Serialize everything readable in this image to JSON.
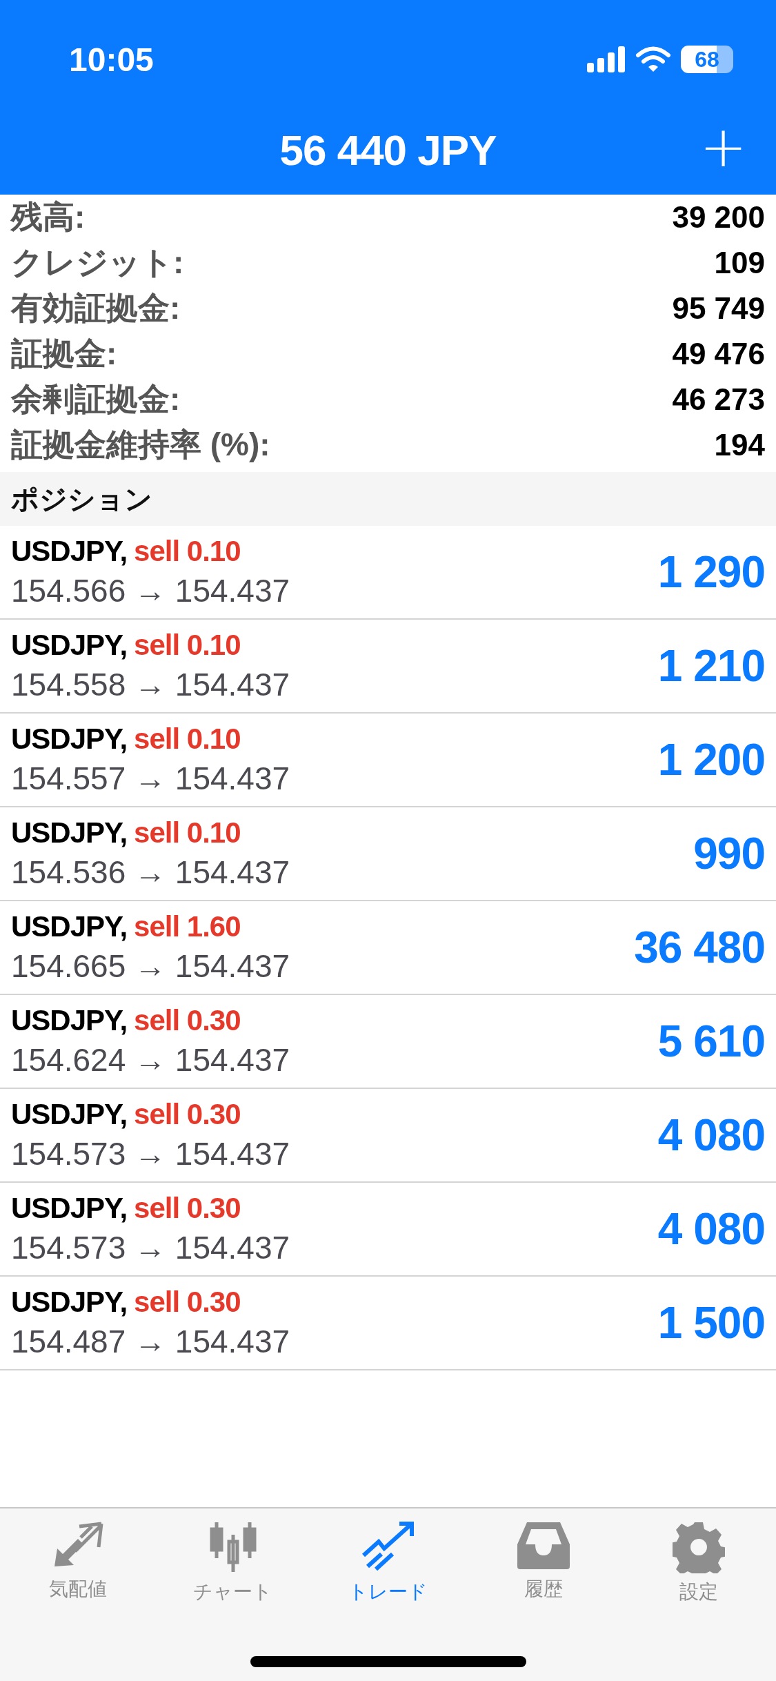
{
  "status_bar": {
    "time": "10:05",
    "battery": "68"
  },
  "header": {
    "title": "56 440 JPY",
    "add_button": "+"
  },
  "summary": [
    {
      "label": "残高:",
      "value": "39 200"
    },
    {
      "label": "クレジット:",
      "value": "109"
    },
    {
      "label": "有効証拠金:",
      "value": "95 749"
    },
    {
      "label": "証拠金:",
      "value": "49 476"
    },
    {
      "label": "余剰証拠金:",
      "value": "46 273"
    },
    {
      "label": "証拠金維持率 (%):",
      "value": "194"
    }
  ],
  "section_title": "ポジション",
  "positions": [
    {
      "symbol": "USDJPY,",
      "order": "sell 0.10",
      "prices": "154.566 → 154.437",
      "profit": "1 290"
    },
    {
      "symbol": "USDJPY,",
      "order": "sell 0.10",
      "prices": "154.558 → 154.437",
      "profit": "1 210"
    },
    {
      "symbol": "USDJPY,",
      "order": "sell 0.10",
      "prices": "154.557 → 154.437",
      "profit": "1 200"
    },
    {
      "symbol": "USDJPY,",
      "order": "sell 0.10",
      "prices": "154.536 → 154.437",
      "profit": "990"
    },
    {
      "symbol": "USDJPY,",
      "order": "sell 1.60",
      "prices": "154.665 → 154.437",
      "profit": "36 480"
    },
    {
      "symbol": "USDJPY,",
      "order": "sell 0.30",
      "prices": "154.624 → 154.437",
      "profit": "5 610"
    },
    {
      "symbol": "USDJPY,",
      "order": "sell 0.30",
      "prices": "154.573 → 154.437",
      "profit": "4 080"
    },
    {
      "symbol": "USDJPY,",
      "order": "sell 0.30",
      "prices": "154.573 → 154.437",
      "profit": "4 080"
    },
    {
      "symbol": "USDJPY,",
      "order": "sell 0.30",
      "prices": "154.487 → 154.437",
      "profit": "1 500"
    }
  ],
  "tabs": [
    {
      "kind": "quotes",
      "label": "気配値",
      "selected": false
    },
    {
      "kind": "chart",
      "label": "チャート",
      "selected": false
    },
    {
      "kind": "trade",
      "label": "トレード",
      "selected": true
    },
    {
      "kind": "history",
      "label": "履歴",
      "selected": false
    },
    {
      "kind": "settings",
      "label": "設定",
      "selected": false
    }
  ]
}
